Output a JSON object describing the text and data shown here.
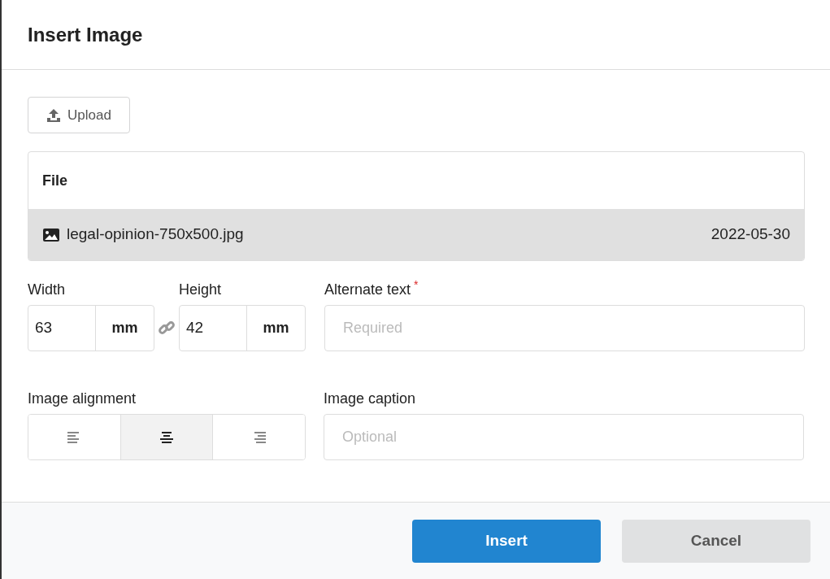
{
  "dialog": {
    "title": "Insert Image"
  },
  "upload_button": {
    "label": "Upload"
  },
  "file_table": {
    "column": "File",
    "rows": [
      {
        "name": "legal-opinion-750x500.jpg",
        "date": "2022-05-30",
        "selected": true
      }
    ]
  },
  "size": [
    {
      "label": "Width",
      "value": "63",
      "unit": "mm"
    },
    {
      "label": "Height",
      "value": "42",
      "unit": "mm"
    }
  ],
  "alt_text": {
    "label": "Alternate text",
    "required_mark": "*",
    "placeholder": "Required"
  },
  "alignment": {
    "label": "Image alignment",
    "options": [
      {
        "kind": "left",
        "selected": false
      },
      {
        "kind": "center",
        "selected": true
      },
      {
        "kind": "right",
        "selected": false
      }
    ]
  },
  "caption": {
    "label": "Image caption",
    "placeholder": "Optional"
  },
  "buttons": [
    {
      "label": "Insert",
      "kind": "primary"
    },
    {
      "label": "Cancel",
      "kind": "secondary"
    }
  ]
}
